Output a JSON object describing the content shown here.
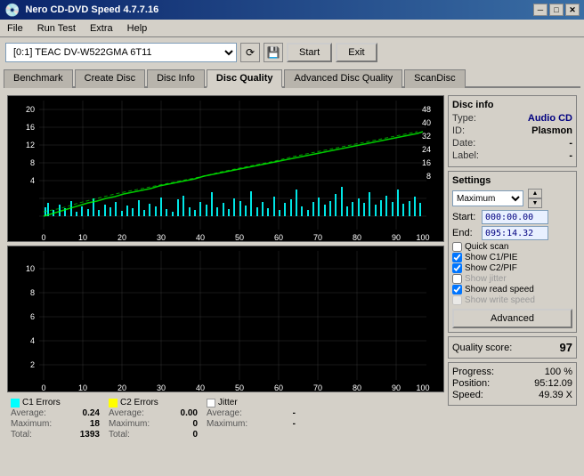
{
  "titleBar": {
    "title": "Nero CD-DVD Speed 4.7.7.16",
    "minimize": "─",
    "maximize": "□",
    "close": "✕"
  },
  "menu": {
    "items": [
      "File",
      "Run Test",
      "Extra",
      "Help"
    ]
  },
  "toolbar": {
    "drive": "[0:1]  TEAC DV-W522GMA 6T11",
    "start": "Start",
    "exit": "Exit"
  },
  "tabs": [
    {
      "label": "Benchmark",
      "active": false
    },
    {
      "label": "Create Disc",
      "active": false
    },
    {
      "label": "Disc Info",
      "active": false
    },
    {
      "label": "Disc Quality",
      "active": true
    },
    {
      "label": "Advanced Disc Quality",
      "active": false
    },
    {
      "label": "ScanDisc",
      "active": false
    }
  ],
  "discInfo": {
    "title": "Disc info",
    "type_label": "Type:",
    "type_value": "Audio CD",
    "id_label": "ID:",
    "id_value": "Plasmon",
    "date_label": "Date:",
    "date_value": "-",
    "label_label": "Label:",
    "label_value": "-"
  },
  "settings": {
    "title": "Settings",
    "speed": "Maximum",
    "start_label": "Start:",
    "start_value": "000:00.00",
    "end_label": "End:",
    "end_value": "095:14.32",
    "quick_scan": "Quick scan",
    "show_c1pie": "Show C1/PIE",
    "show_c2pif": "Show C2/PIF",
    "show_jitter": "Show jitter",
    "show_read_speed": "Show read speed",
    "show_write_speed": "Show write speed",
    "advanced": "Advanced"
  },
  "qualityScore": {
    "label": "Quality score:",
    "value": "97"
  },
  "progress": {
    "progress_label": "Progress:",
    "progress_value": "100 %",
    "position_label": "Position:",
    "position_value": "95:12.09",
    "speed_label": "Speed:",
    "speed_value": "49.39 X"
  },
  "legend": {
    "c1": {
      "title": "C1 Errors",
      "color": "#00ffff",
      "avg_label": "Average:",
      "avg_value": "0.24",
      "max_label": "Maximum:",
      "max_value": "18",
      "total_label": "Total:",
      "total_value": "1393"
    },
    "c2": {
      "title": "C2 Errors",
      "color": "#ffff00",
      "avg_label": "Average:",
      "avg_value": "0.00",
      "max_label": "Maximum:",
      "max_value": "0",
      "total_label": "Total:",
      "total_value": "0"
    },
    "jitter": {
      "title": "Jitter",
      "color": "#ffffff",
      "avg_label": "Average:",
      "avg_value": "-",
      "max_label": "Maximum:",
      "max_value": "-"
    }
  },
  "chart": {
    "top_y_labels": [
      "20",
      "",
      "16",
      "",
      "12",
      "",
      "8",
      "",
      "4",
      "",
      "",
      "48",
      "40",
      "32",
      "24",
      "16",
      "8"
    ],
    "bottom_y_labels": [
      "10",
      "8",
      "6",
      "4",
      "2"
    ],
    "x_labels": [
      "0",
      "10",
      "20",
      "30",
      "40",
      "50",
      "60",
      "70",
      "80",
      "90",
      "100"
    ]
  }
}
